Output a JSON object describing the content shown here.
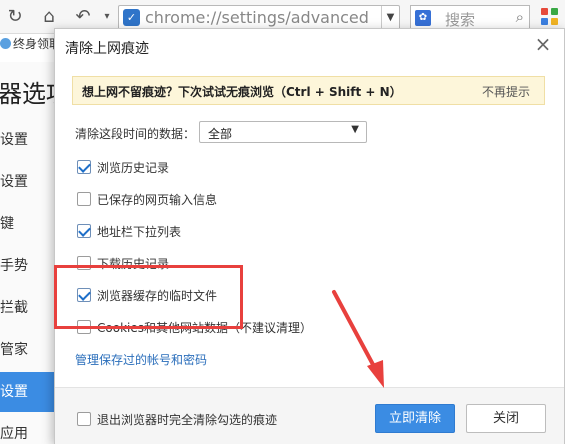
{
  "browser": {
    "address_text": "chrome://settings/advanced",
    "search_placeholder": "搜索",
    "bookmark_label": "终身领取",
    "settings_title": "器选项",
    "side_items": [
      "设置",
      "设置",
      "键",
      "手势",
      "拦截",
      "管家",
      "设置",
      "应用"
    ],
    "active_index": 6
  },
  "dialog": {
    "title": "清除上网痕迹",
    "notice": {
      "text": "想上网不留痕迹？下次试试无痕浏览（Ctrl + Shift + N）",
      "dismiss": "不再提示"
    },
    "range": {
      "label": "清除这段时间的数据：",
      "selected": "全部"
    },
    "options": [
      {
        "label": "浏览历史记录",
        "checked": true
      },
      {
        "label": "已保存的网页输入信息",
        "checked": false
      },
      {
        "label": "地址栏下拉列表",
        "checked": true
      },
      {
        "label": "下载历史记录",
        "checked": false
      },
      {
        "label": "浏览器缓存的临时文件",
        "checked": true
      },
      {
        "label": "Cookies和其他网站数据（不建议清理）",
        "checked": false
      }
    ],
    "manage_link": "管理保存过的帐号和密码",
    "footer": {
      "exit_clear_label": "退出浏览器时完全清除勾选的痕迹",
      "exit_clear_checked": false,
      "primary_button": "立即清除",
      "secondary_button": "关闭"
    }
  },
  "colors": {
    "accent": "#3b8ce3",
    "notice_bg": "#fdf6da",
    "annotation": "#e8403d"
  }
}
